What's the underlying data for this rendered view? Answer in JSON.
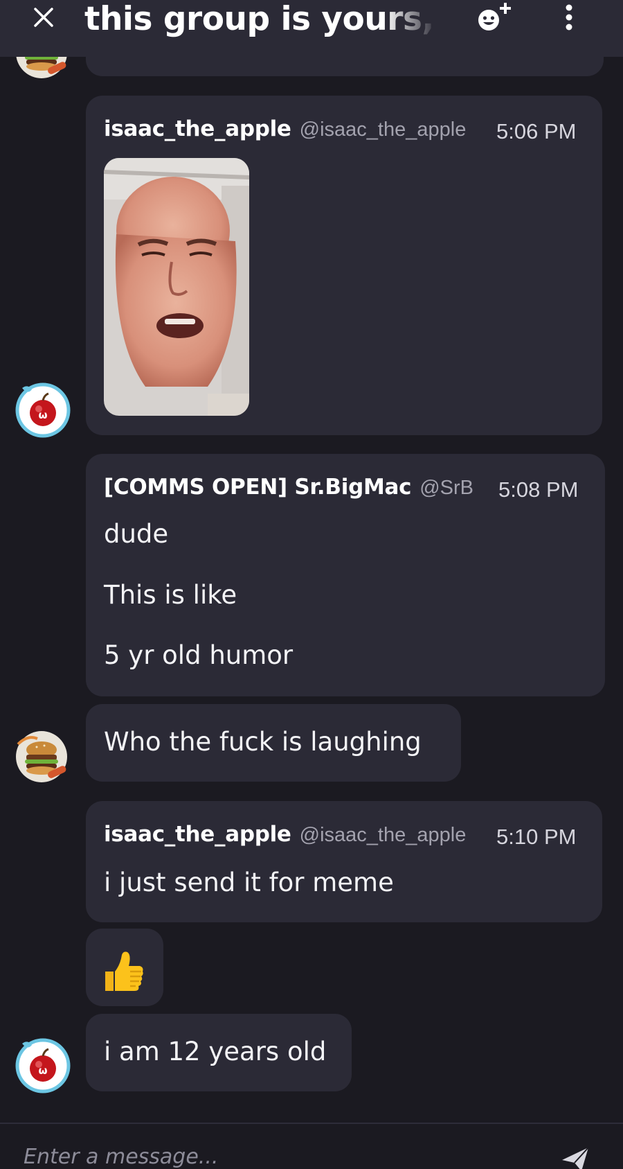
{
  "header": {
    "title": "this group is yours, j",
    "close_icon": "close-icon",
    "add_emoji_icon": "add-emoji-icon",
    "more_icon": "more-vertical-icon",
    "background": "#2b2a36"
  },
  "messages": [
    {
      "author": "isaac_the_apple",
      "handle": "@isaac_the_apple",
      "time": "5:06 PM",
      "attachment": "video-thumbnail",
      "avatar": "apple-avatar"
    },
    {
      "author": "[COMMS OPEN] Sr.BigMac",
      "handle": "@SrB",
      "time": "5:08 PM",
      "lines": [
        "dude",
        "This is like",
        "5 yr old humor"
      ],
      "avatar": "bigmac-avatar"
    },
    {
      "text": "Who the fuck is laughing",
      "avatar": "bigmac-avatar"
    },
    {
      "author": "isaac_the_apple",
      "handle": "@isaac_the_apple",
      "time": "5:10 PM",
      "text": "i just send it for meme",
      "avatar": "apple-avatar"
    },
    {
      "emoji": "👍",
      "emoji_name": "thumbs-up"
    },
    {
      "text": "i am 12 years old",
      "avatar": "apple-avatar"
    }
  ],
  "composer": {
    "placeholder": "Enter a message...",
    "send_icon": "send-icon"
  },
  "colors": {
    "background": "#1b1a21",
    "bubble": "#2b2a36",
    "handle": "#a3a2ae"
  }
}
